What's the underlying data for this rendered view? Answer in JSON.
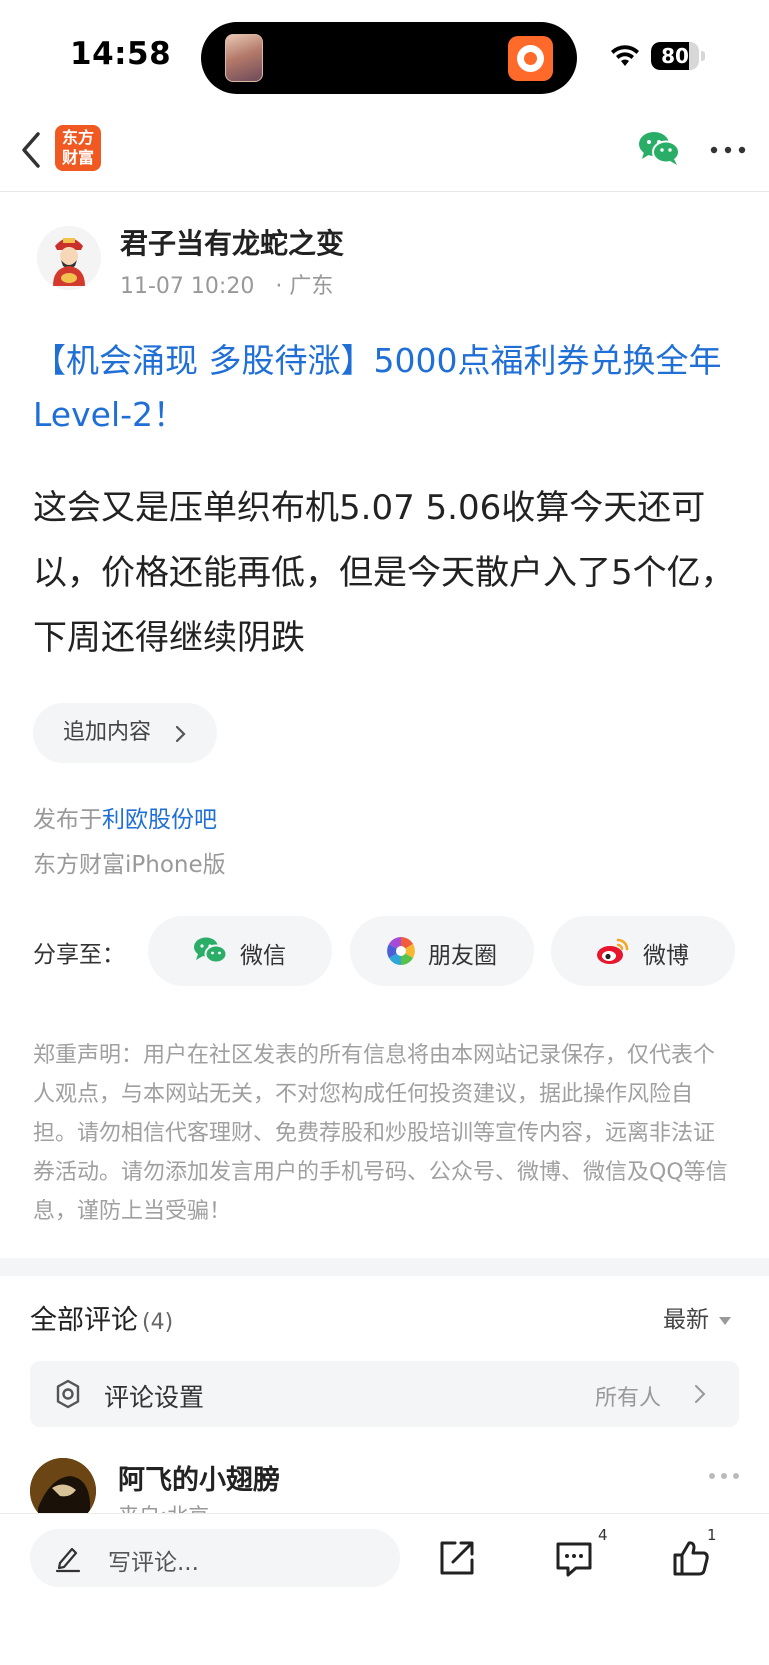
{
  "status": {
    "time": "14:58",
    "battery": "80",
    "battery_level": 0.8
  },
  "nav": {
    "logo_text_line1": "东方",
    "logo_text_line2": "财富"
  },
  "post": {
    "author": "君子当有龙蛇之变",
    "date": "11-07 10:20",
    "location": "· 广东",
    "title": "【机会涌现 多股待涨】5000点福利券兑换全年Level-2！",
    "body": "这会又是压单织布机5.07 5.06收算今天还可以，价格还能再低，但是今天散户入了5个亿，下周还得继续阴跌",
    "add_content_label": "追加内容",
    "published_prefix": "发布于",
    "published_bar": "利欧股份吧",
    "client": "东方财富iPhone版"
  },
  "share": {
    "label": "分享至：",
    "wechat": "微信",
    "moments": "朋友圈",
    "weibo": "微博"
  },
  "disclaimer": "郑重声明：用户在社区发表的所有信息将由本网站记录保存，仅代表个人观点，与本网站无关，不对您构成任何投资建议，据此操作风险自担。请勿相信代客理财、免费荐股和炒股培训等宣传内容，远离非法证券活动。请勿添加发言用户的手机号码、公众号、微博、微信及QQ等信息，谨防上当受骗！",
  "comments": {
    "title": "全部评论",
    "count": "(4)",
    "sort": "最新",
    "settings_label": "评论设置",
    "settings_value": "所有人",
    "first": {
      "user": "阿飞的小翅膀",
      "location": "来自:北京"
    }
  },
  "bottom_bar": {
    "placeholder": "写评论...",
    "comment_count": "4",
    "like_count": "1"
  },
  "colors": {
    "brand": "#f05a22",
    "link": "#1f6fd6",
    "wechat": "#2aae67"
  }
}
